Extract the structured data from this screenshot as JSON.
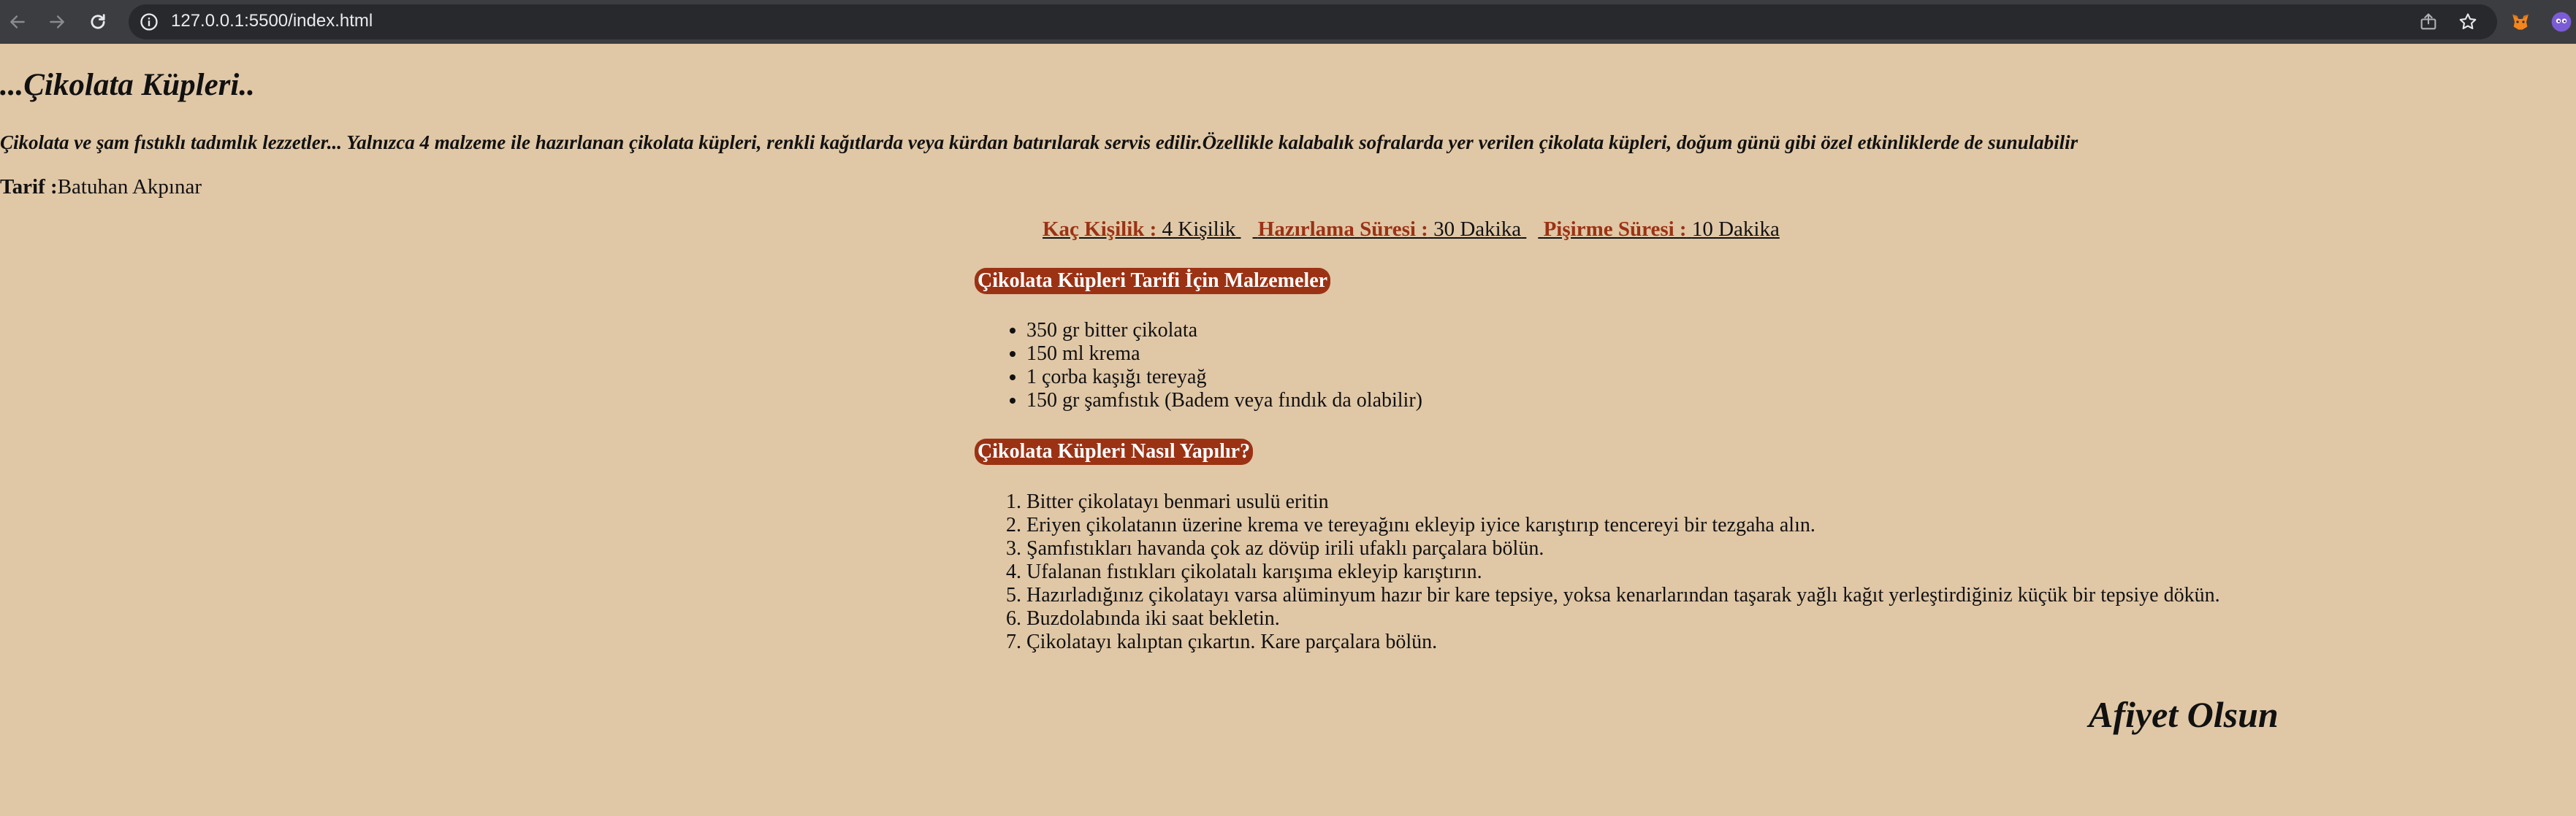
{
  "browser": {
    "url": "127.0.0.1:5500/index.html",
    "icons": {
      "back": "back-arrow-icon",
      "forward": "forward-arrow-icon",
      "reload": "reload-icon",
      "info": "site-info-icon",
      "share": "share-icon",
      "bookmark": "bookmark-star-icon",
      "extension_1": "metamask-fox-icon",
      "extension_2": "extension-icon"
    }
  },
  "page": {
    "title": "...Çikolata Küpleri..",
    "intro": "Çikolata ve şam fıstıklı tadımlık lezzetler... Yalnızca 4 malzeme ile hazırlanan çikolata küpleri, renkli kağıtlarda veya kürdan batırılarak servis edilir.Özellikle kalabalık sofralarda yer verilen çikolata küpleri, doğum günü gibi özel etkinliklerde de sunulabilir",
    "author_label": "Tarif :",
    "author_name": "Batuhan Akpınar",
    "meta": {
      "servings_label": "Kaç Kişilik :",
      "servings_value": "4 Kişilik",
      "prep_label": "Hazırlama Süresi :",
      "prep_value": "30 Dakika",
      "cook_label": "Pişirme Süresi :",
      "cook_value": "10 Dakika"
    },
    "ingredients_heading": "Çikolata Küpleri Tarifi İçin Malzemeler",
    "ingredients": [
      "350 gr bitter çikolata",
      "150 ml krema",
      "1 çorba kaşığı tereyağ",
      "150 gr şamfıstık (Badem veya fındık da olabilir)"
    ],
    "steps_heading": "Çikolata Küpleri Nasıl Yapılır?",
    "steps": [
      "Bitter çikolatayı benmari usulü eritin",
      "Eriyen çikolatanın üzerine krema ve tereyağını ekleyip iyice karıştırıp tencereyi bir tezgaha alın.",
      "Şamfıstıkları havanda çok az dövüp irili ufaklı parçalara bölün.",
      "Ufalanan fıstıkları çikolatalı karışıma ekleyip karıştırın.",
      "Hazırladığınız çikolatayı varsa alüminyum hazır bir kare tepsiye, yoksa kenarlarından taşarak yağlı kağıt yerleştirdiğiniz küçük bir tepsiye dökün.",
      "Buzdolabında iki saat bekletin.",
      "Çikolatayı kalıptan çıkartın. Kare parçalara bölün."
    ],
    "closing": "Afiyet Olsun"
  },
  "colors": {
    "page_background": "#e0c7a6",
    "accent": "#9b3214",
    "heading_text": "#ffffff",
    "chrome_background": "#3c3d40"
  }
}
